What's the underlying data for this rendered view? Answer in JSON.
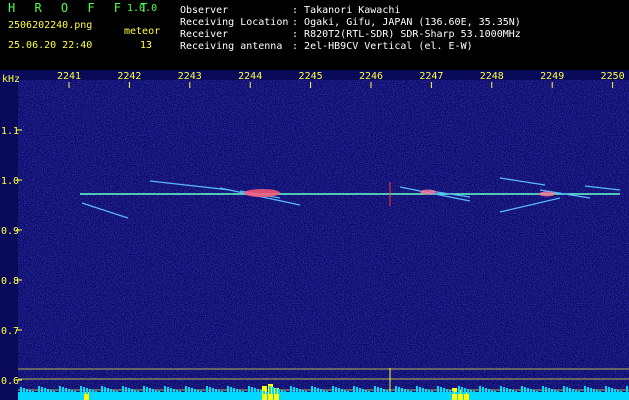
{
  "app": {
    "name": "H R O F F T",
    "version": "1.0.0"
  },
  "file": {
    "name": "2506202240.png",
    "datetime": "25.06.20 22:40"
  },
  "meteor": {
    "label": "meteor",
    "count": "13"
  },
  "station": [
    {
      "label": "Observer",
      "value": "Takanori Kawachi"
    },
    {
      "label": "Receiving Location",
      "value": "Ogaki, Gifu, JAPAN (136.60E, 35.35N)"
    },
    {
      "label": "Receiver",
      "value": "R820T2(RTL-SDR) SDR-Sharp 53.1000MHz"
    },
    {
      "label": "Receiving antenna",
      "value": "2el-HB9CV Vertical (el. E-W)"
    }
  ],
  "axis": {
    "unit": "kHz",
    "y_ticks": [
      "1.1",
      "1.0",
      "0.9",
      "0.8",
      "0.7",
      "0.6"
    ],
    "x_ticks": [
      "2241",
      "2242",
      "2243",
      "2244",
      "2245",
      "2246",
      "2247",
      "2248",
      "2249",
      "2250"
    ]
  },
  "colors": {
    "background": "#000000",
    "spectrum_bg": "#0a0a5a",
    "text_yellow": "#ffff3c",
    "text_green": "#4cff4c",
    "text_white": "#ffffff",
    "carrier": "#66ffcc",
    "level_bars": "#00d8ff",
    "level_peak": "#ffff00"
  }
}
